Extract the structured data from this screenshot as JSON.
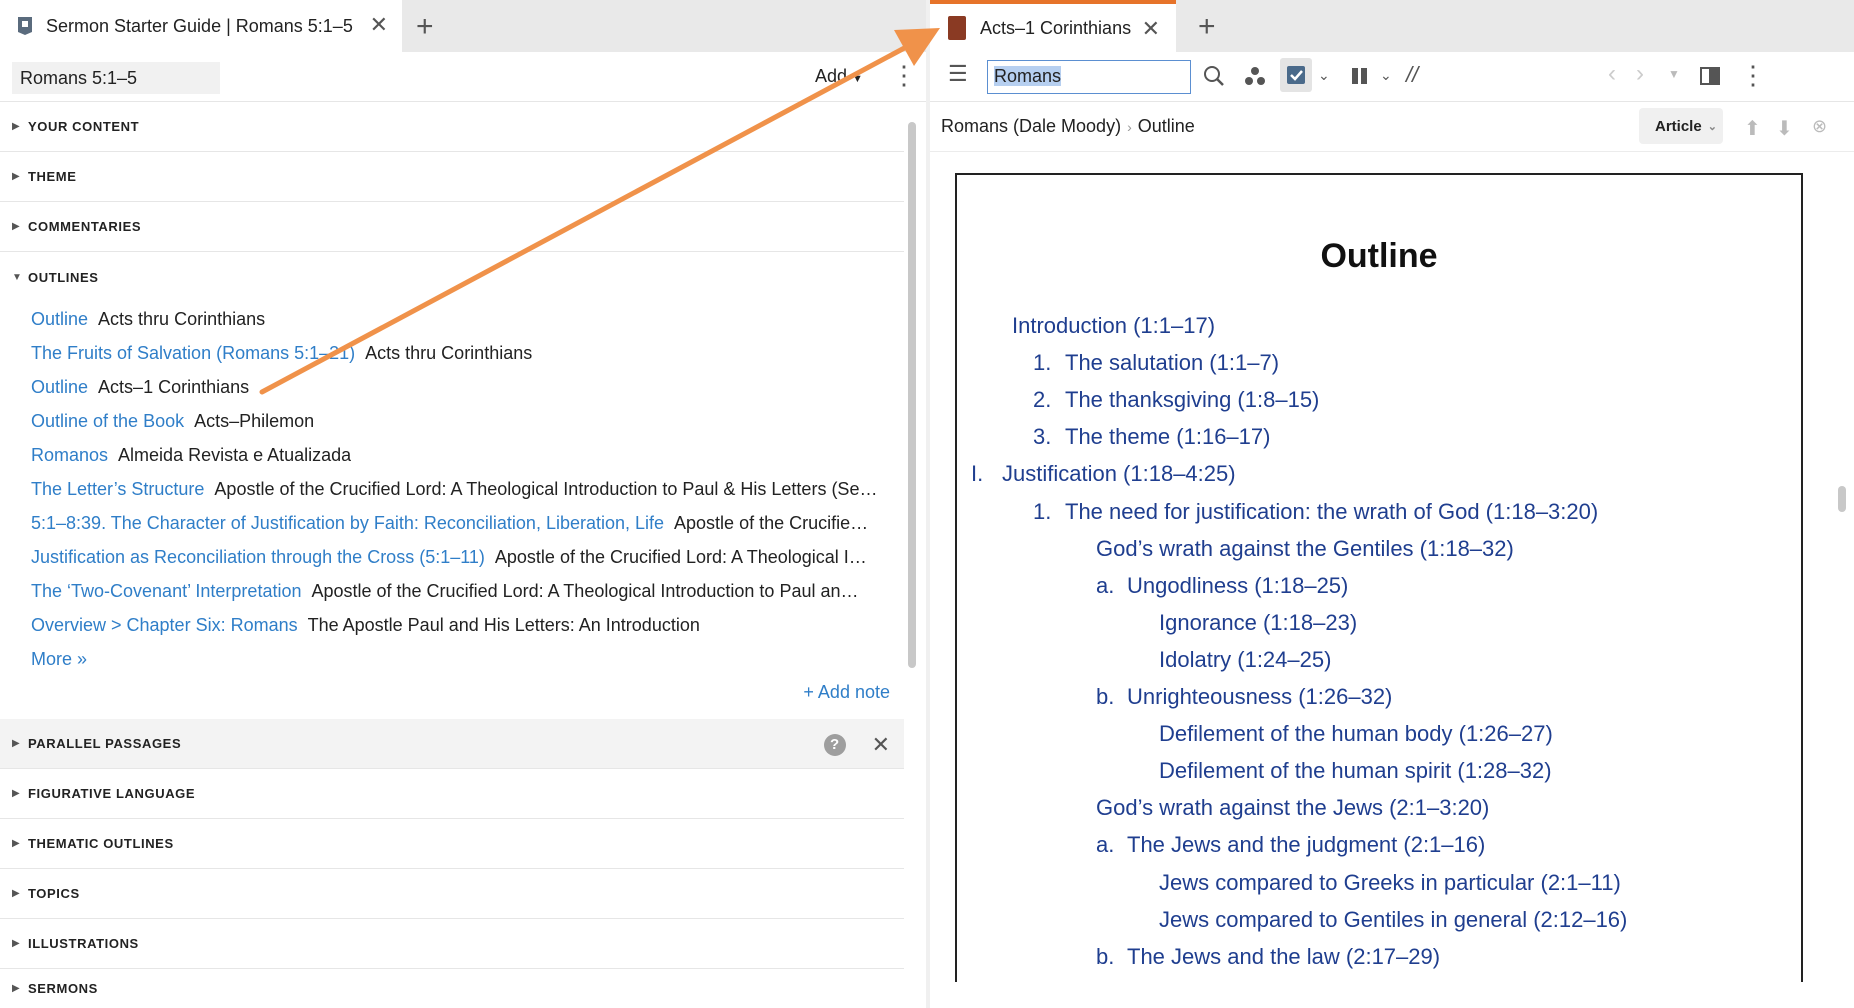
{
  "left_tab": {
    "title": "Sermon Starter Guide | Romans 5:1–5"
  },
  "left_header": {
    "reference": "Romans 5:1–5",
    "add_label": "Add"
  },
  "sections_top": [
    {
      "label": "YOUR CONTENT"
    },
    {
      "label": "THEME"
    },
    {
      "label": "COMMENTARIES"
    },
    {
      "label": "OUTLINES"
    }
  ],
  "outlines": [
    {
      "link": "Outline",
      "source": "Acts thru Corinthians"
    },
    {
      "link": "The Fruits of Salvation (Romans 5:1–21)",
      "source": "Acts thru Corinthians"
    },
    {
      "link": "Outline",
      "source": "Acts–1 Corinthians"
    },
    {
      "link": "Outline of the Book",
      "source": "Acts–Philemon"
    },
    {
      "link": "Romanos",
      "source": "Almeida Revista e Atualizada"
    },
    {
      "link": "The Letter’s Structure",
      "source": "Apostle of the Crucified Lord: A Theological Introduction to Paul & His Letters (Se…"
    },
    {
      "link": "5:1–8:39. The Character of Justification by Faith: Reconciliation, Liberation, Life",
      "source": "Apostle of the Crucifie…"
    },
    {
      "link": "Justification as Reconciliation through the Cross (5:1–11)",
      "source": "Apostle of the Crucified Lord: A Theological I…"
    },
    {
      "link": "The ‘Two-Covenant’ Interpretation",
      "source": "Apostle of the Crucified Lord: A Theological Introduction to Paul an…"
    },
    {
      "link": "Overview > Chapter Six: Romans",
      "source": "The Apostle Paul and His Letters: An Introduction"
    }
  ],
  "more_label": "More »",
  "add_note_label": "+ Add note",
  "sections_bottom": [
    {
      "label": "PARALLEL PASSAGES"
    },
    {
      "label": "FIGURATIVE LANGUAGE"
    },
    {
      "label": "THEMATIC OUTLINES"
    },
    {
      "label": "TOPICS"
    },
    {
      "label": "ILLUSTRATIONS"
    },
    {
      "label": "SERMONS"
    }
  ],
  "right_tab": {
    "title": "Acts–1 Corinthians"
  },
  "right_toolbar": {
    "search_value": "Romans"
  },
  "breadcrumb": {
    "resource": "Romans (Dale Moody)",
    "section": "Outline"
  },
  "article_label": "Article",
  "page": {
    "title": "Outline",
    "lines": [
      {
        "marker": "",
        "text": "Introduction (1:1–17)"
      },
      {
        "marker": "1.",
        "text": "The salutation (1:1–7)"
      },
      {
        "marker": "2.",
        "text": "The thanksgiving (1:8–15)"
      },
      {
        "marker": "3.",
        "text": "The theme (1:16–17)"
      },
      {
        "marker": "I.",
        "text": "Justification (1:18–4:25)"
      },
      {
        "marker": "1.",
        "text": "The need for justification: the wrath of God (1:18–3:20)"
      },
      {
        "marker": "",
        "text": "God’s wrath against the Gentiles (1:18–32)"
      },
      {
        "marker": "a.",
        "text": "Ungodliness (1:18–25)"
      },
      {
        "marker": "",
        "text": "Ignorance (1:18–23)"
      },
      {
        "marker": "",
        "text": "Idolatry (1:24–25)"
      },
      {
        "marker": "b.",
        "text": "Unrighteousness (1:26–32)"
      },
      {
        "marker": "",
        "text": "Defilement of the human body (1:26–27)"
      },
      {
        "marker": "",
        "text": "Defilement of the human spirit (1:28–32)"
      },
      {
        "marker": "",
        "text": "God’s wrath against the Jews (2:1–3:20)"
      },
      {
        "marker": "a.",
        "text": "The Jews and the judgment (2:1–16)"
      },
      {
        "marker": "",
        "text": "Jews compared to Greeks in particular (2:1–11)"
      },
      {
        "marker": "",
        "text": "Jews compared to Gentiles in general (2:12–16)"
      },
      {
        "marker": "b.",
        "text": "The Jews and the law (2:17–29)"
      }
    ]
  },
  "colors": {
    "link": "#2f7ec8",
    "outline_text": "#1f3e8f",
    "accent": "#e6732a",
    "arrow": "#f0924a"
  }
}
